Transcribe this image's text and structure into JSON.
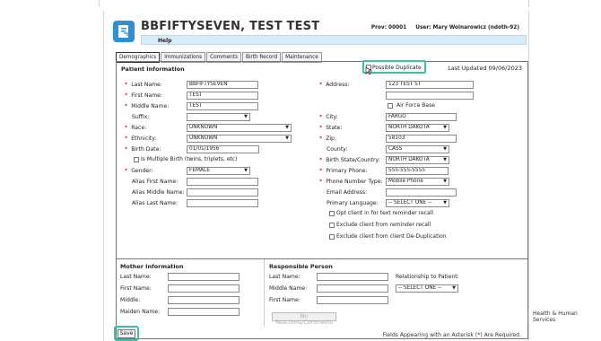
{
  "header": {
    "title": "BBFIFTYSEVEN, TEST TEST",
    "prov": "Prov: 00001",
    "user": "User: Mary Woinarowicz (ndoth-92)"
  },
  "menu": {
    "help": "Help"
  },
  "tabs": [
    "Demographics",
    "Immunizations",
    "Comments",
    "Birth Record",
    "Maintenance"
  ],
  "patient": {
    "section_title": "Patient Information",
    "possible_duplicate": "Possible Duplicate",
    "last_updated": "Last Updated 09/06/2023",
    "labels": {
      "last_name": "Last Name:",
      "first_name": "First Name:",
      "middle_name": "Middle Name:",
      "suffix": "Suffix:",
      "race": "Race:",
      "ethnicity": "Ethnicity:",
      "birth_date": "Birth Date:",
      "multiple_birth": "Is Multiple Birth (twins, triplets, etc)",
      "gender": "Gender:",
      "alias_first": "Alias First Name:",
      "alias_middle": "Alias Middle Name:",
      "alias_last": "Alias Last Name:",
      "address": "Address:",
      "air_force": "Air Force Base",
      "city": "City:",
      "state": "State:",
      "zip": "Zip:",
      "county": "County:",
      "birth_state": "Birth State/Country:",
      "primary_phone": "Primary Phone:",
      "phone_type": "Phone Number Type:",
      "email": "Email Address:",
      "primary_language": "Primary Language:",
      "opt_text": "Opt client in for text reminder recall",
      "exclude_reminder": "Exclude client from reminder recall",
      "exclude_dedup": "Exclude client from client De-Duplication"
    },
    "values": {
      "last_name": "BBFIFTYSEVEN",
      "first_name": "TEST",
      "middle_name": "TEST",
      "suffix": "",
      "race": "UNKNOWN",
      "ethnicity": "UNKNOWN",
      "birth_date": "01/01/1956",
      "gender": "FEMALE",
      "alias_first": "",
      "alias_middle": "",
      "alias_last": "",
      "address_1": "123 TEST ST",
      "address_2": "",
      "city": "FARGO",
      "state": "NORTH DAKOTA",
      "zip": "58103",
      "county": "CASS",
      "birth_state": "NORTH DAKOTA",
      "primary_phone": "555-555-5555",
      "phone_type": "Mobile Phone",
      "email": "",
      "primary_language": "-- SELECT ONE --"
    }
  },
  "mother": {
    "title": "Mother Information",
    "labels": [
      "Last Name:",
      "First Name:",
      "Middle:",
      "Maiden Name:"
    ],
    "values": [
      "",
      "",
      "",
      ""
    ]
  },
  "responsible": {
    "title": "Responsible Person",
    "labels": [
      "Last Name:",
      "Middle Name:",
      "First Name:"
    ],
    "values": [
      "",
      "",
      ""
    ],
    "relationship_label": "Relationship to Patient:",
    "relationship_value": "-- SELECT ONE --",
    "no_reactions": "No Reactions/Comments"
  },
  "save": "Save",
  "footer": {
    "asterisk_note_prefix": "Fields Appearing with an Asterisk (",
    "asterisk": "*",
    "asterisk_note_suffix": ") Are Required."
  },
  "brand": {
    "side_text": "Health & Human Services"
  },
  "colors": {
    "accent": "#2f8fd7",
    "required": "#d82d2d",
    "highlight": "#3bbfa7"
  }
}
